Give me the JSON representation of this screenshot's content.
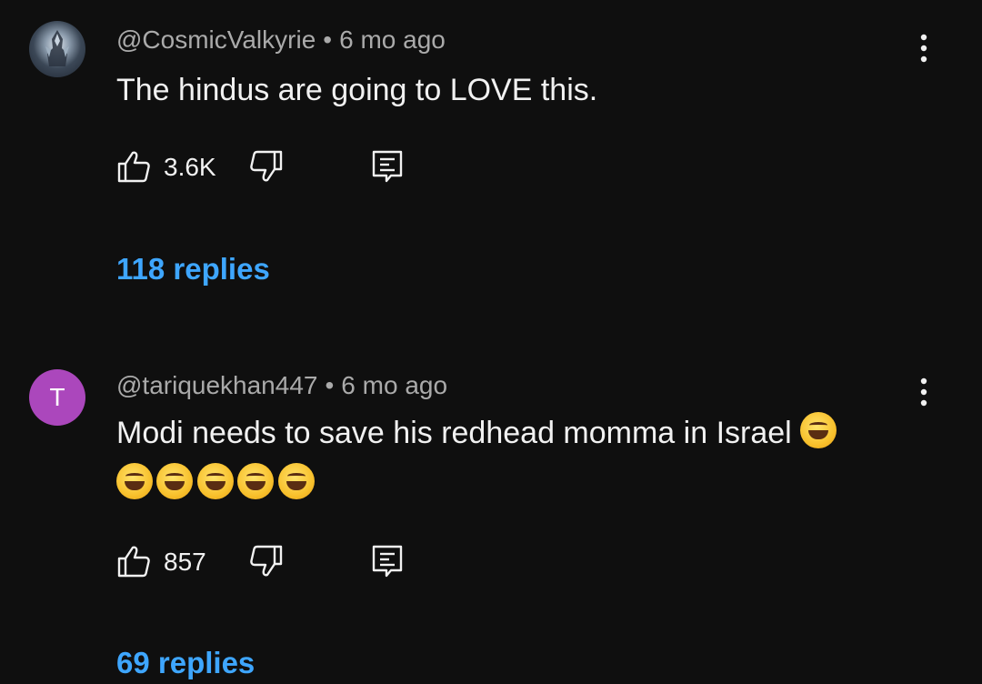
{
  "comments": [
    {
      "handle": "@CosmicValkyrie",
      "separator": "•",
      "time": "6 mo ago",
      "text": "The hindus are going to LOVE this.",
      "likes": "3.6K",
      "replies": "118 replies",
      "avatar": "knight-avatar-image"
    },
    {
      "handle": "@tariquekhan447",
      "separator": "•",
      "time": "6 mo ago",
      "avatar_letter": "T",
      "avatar_color": "#ab47bc",
      "text": "Modi needs to save his redhead momma in Israel",
      "emojis_inline": "😂",
      "emojis_row": "😅😂😅😂😅",
      "likes": "857",
      "replies": "69 replies"
    }
  ],
  "colors": {
    "background": "#0f0f0f",
    "text": "#f1f1f1",
    "meta": "#aaaaaa",
    "link": "#3ea6ff"
  },
  "icons": [
    "thumbs-up-icon",
    "thumbs-down-icon",
    "reply-icon",
    "more-vertical-icon"
  ]
}
